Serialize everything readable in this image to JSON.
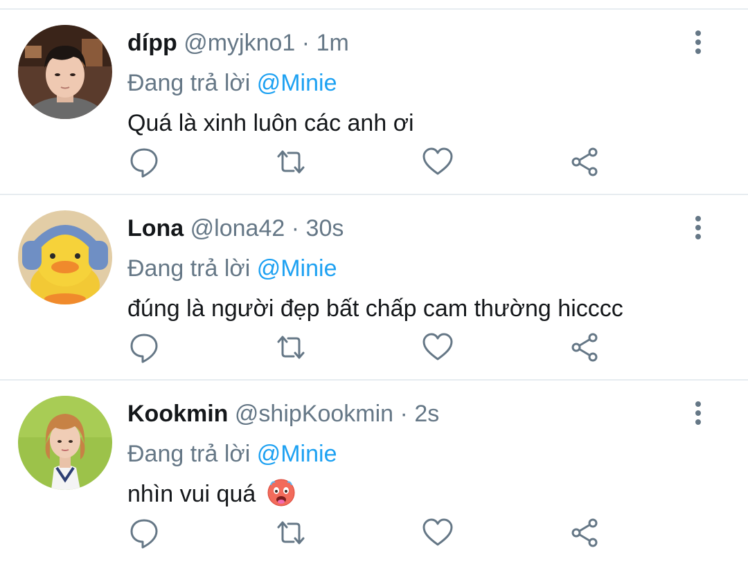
{
  "tweets": [
    {
      "name": "dípp",
      "handle": "@myjkno1",
      "separator": "·",
      "time": "1m",
      "reply_prefix": "Đang trả lời",
      "reply_to": "@Minie",
      "text": "Quá là xinh luôn các anh ơi"
    },
    {
      "name": "Lona",
      "handle": "@lona42",
      "separator": "·",
      "time": "30s",
      "reply_prefix": "Đang trả lời",
      "reply_to": "@Minie",
      "text": "đúng là người đẹp bất chấp cam thường hicccc"
    },
    {
      "name": "Kookmin",
      "handle": "@shipKookmin",
      "separator": "·",
      "time": "2s",
      "reply_prefix": "Đang trả lời",
      "reply_to": "@Minie",
      "text": "nhìn vui quá"
    }
  ],
  "icons": {
    "reply": "reply-icon",
    "retweet": "retweet-icon",
    "like": "heart-icon",
    "share": "share-icon",
    "more": "more-vertical-icon",
    "emoji": "hot-face-emoji"
  },
  "colors": {
    "name": "#14171a",
    "secondary": "#657786",
    "mention": "#1da1f2",
    "divider": "#e6ecf0"
  }
}
